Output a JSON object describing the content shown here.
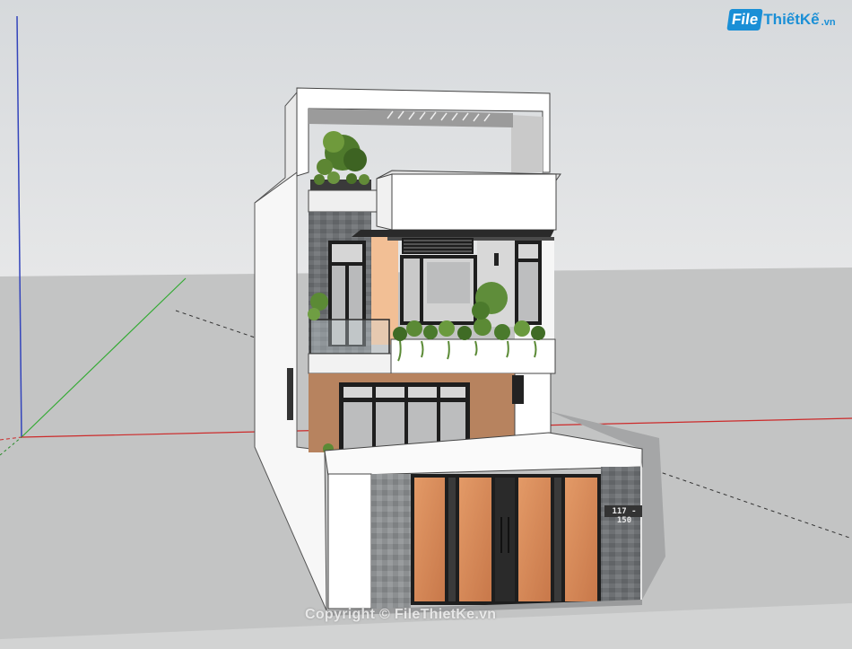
{
  "logo": {
    "box": "File",
    "name": "ThiếtKế",
    "ext": ".vn"
  },
  "house_number": "117 - 150",
  "watermark": "Copyright © FileThietKe.vn",
  "colors": {
    "sky": "#d9dcdf",
    "ground": "#c2c3c3",
    "wall": "#ffffff",
    "wood": "#d9895a",
    "stone": "#6f7275",
    "window_frame": "#1e1e1e",
    "axis_red": "#cc2a2a",
    "axis_green": "#33aa33",
    "axis_blue": "#3344bb",
    "logo_blue": "#1a8fd6"
  }
}
